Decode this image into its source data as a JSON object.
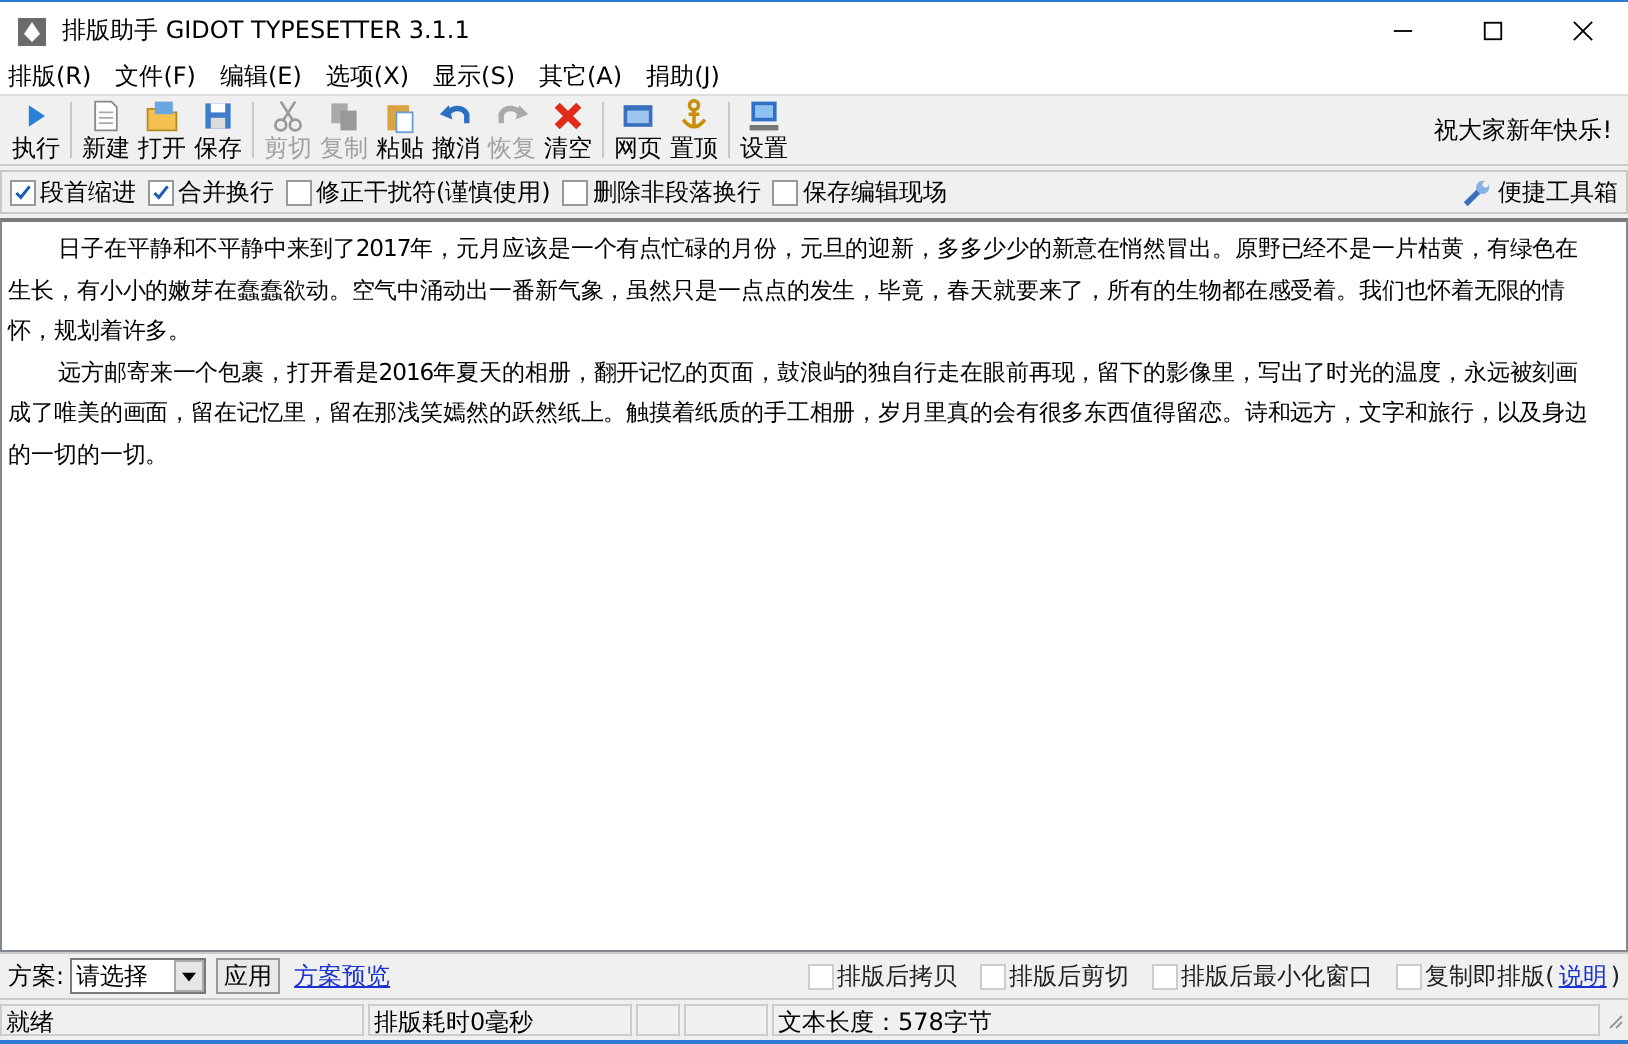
{
  "window": {
    "title": "排版助手 GIDOT TYPESETTER 3.1.1"
  },
  "menu": [
    "排版(R)",
    "文件(F)",
    "编辑(E)",
    "选项(X)",
    "显示(S)",
    "其它(A)",
    "捐助(J)"
  ],
  "toolbar": [
    {
      "kind": "play",
      "label": "执行",
      "disabled": false,
      "group_end": true
    },
    {
      "kind": "new",
      "label": "新建",
      "disabled": false,
      "group_end": false
    },
    {
      "kind": "open",
      "label": "打开",
      "disabled": false,
      "group_end": false
    },
    {
      "kind": "save",
      "label": "保存",
      "disabled": false,
      "group_end": true
    },
    {
      "kind": "cut",
      "label": "剪切",
      "disabled": true,
      "group_end": false
    },
    {
      "kind": "copy",
      "label": "复制",
      "disabled": true,
      "group_end": false
    },
    {
      "kind": "paste",
      "label": "粘贴",
      "disabled": false,
      "group_end": false
    },
    {
      "kind": "undo",
      "label": "撤消",
      "disabled": false,
      "group_end": false
    },
    {
      "kind": "redo",
      "label": "恢复",
      "disabled": true,
      "group_end": false
    },
    {
      "kind": "clear",
      "label": "清空",
      "disabled": false,
      "group_end": true
    },
    {
      "kind": "web",
      "label": "网页",
      "disabled": false,
      "group_end": false
    },
    {
      "kind": "pin",
      "label": "置顶",
      "disabled": false,
      "group_end": true
    },
    {
      "kind": "settings",
      "label": "设置",
      "disabled": false,
      "group_end": false
    }
  ],
  "greeting": "祝大家新年快乐!",
  "options": [
    {
      "label": "段首缩进",
      "checked": true
    },
    {
      "label": "合并换行",
      "checked": true
    },
    {
      "label": "修正干扰符(谨慎使用)",
      "checked": false
    },
    {
      "label": "删除非段落换行",
      "checked": false
    },
    {
      "label": "保存编辑现场",
      "checked": false
    }
  ],
  "toolbox_button": "便捷工具箱",
  "editor": {
    "paragraphs": [
      [
        "日子在平静和不平静中来到了2017年，元月应该是一个有点忙碌的月份，元旦的迎新，多多少少的新意在悄然冒出。原野已经不是一片枯黄，有绿色在",
        "生长，有小小的嫩芽在蠢蠢欲动。空气中涌动出一番新气象，虽然只是一点点的发生，毕竟，春天就要来了，所有的生物都在感受着。我们也怀着无限的情",
        "怀，规划着许多。"
      ],
      [
        "远方邮寄来一个包裹，打开看是2016年夏天的相册，翻开记忆的页面，鼓浪屿的独自行走在眼前再现，留下的影像里，写出了时光的温度，永远被刻画",
        "成了唯美的画面，留在记忆里，留在那浅笑嫣然的跃然纸上。触摸着纸质的手工相册，岁月里真的会有很多东西值得留恋。诗和远方，文字和旅行，以及身边",
        "的一切的一切。"
      ]
    ]
  },
  "scheme": {
    "label": "方案:",
    "value": "请选择",
    "apply": "应用",
    "preview_link": "方案预览"
  },
  "after_options": [
    {
      "label": "排版后拷贝",
      "checked": false
    },
    {
      "label": "排版后剪切",
      "checked": false
    },
    {
      "label": "排版后最小化窗口",
      "checked": false
    },
    {
      "label": "复制即排版(",
      "link": "说明",
      "suffix": ")",
      "checked": false
    }
  ],
  "status_bar": [
    "就绪",
    "排版耗时0毫秒",
    "文本长度：578字节"
  ]
}
